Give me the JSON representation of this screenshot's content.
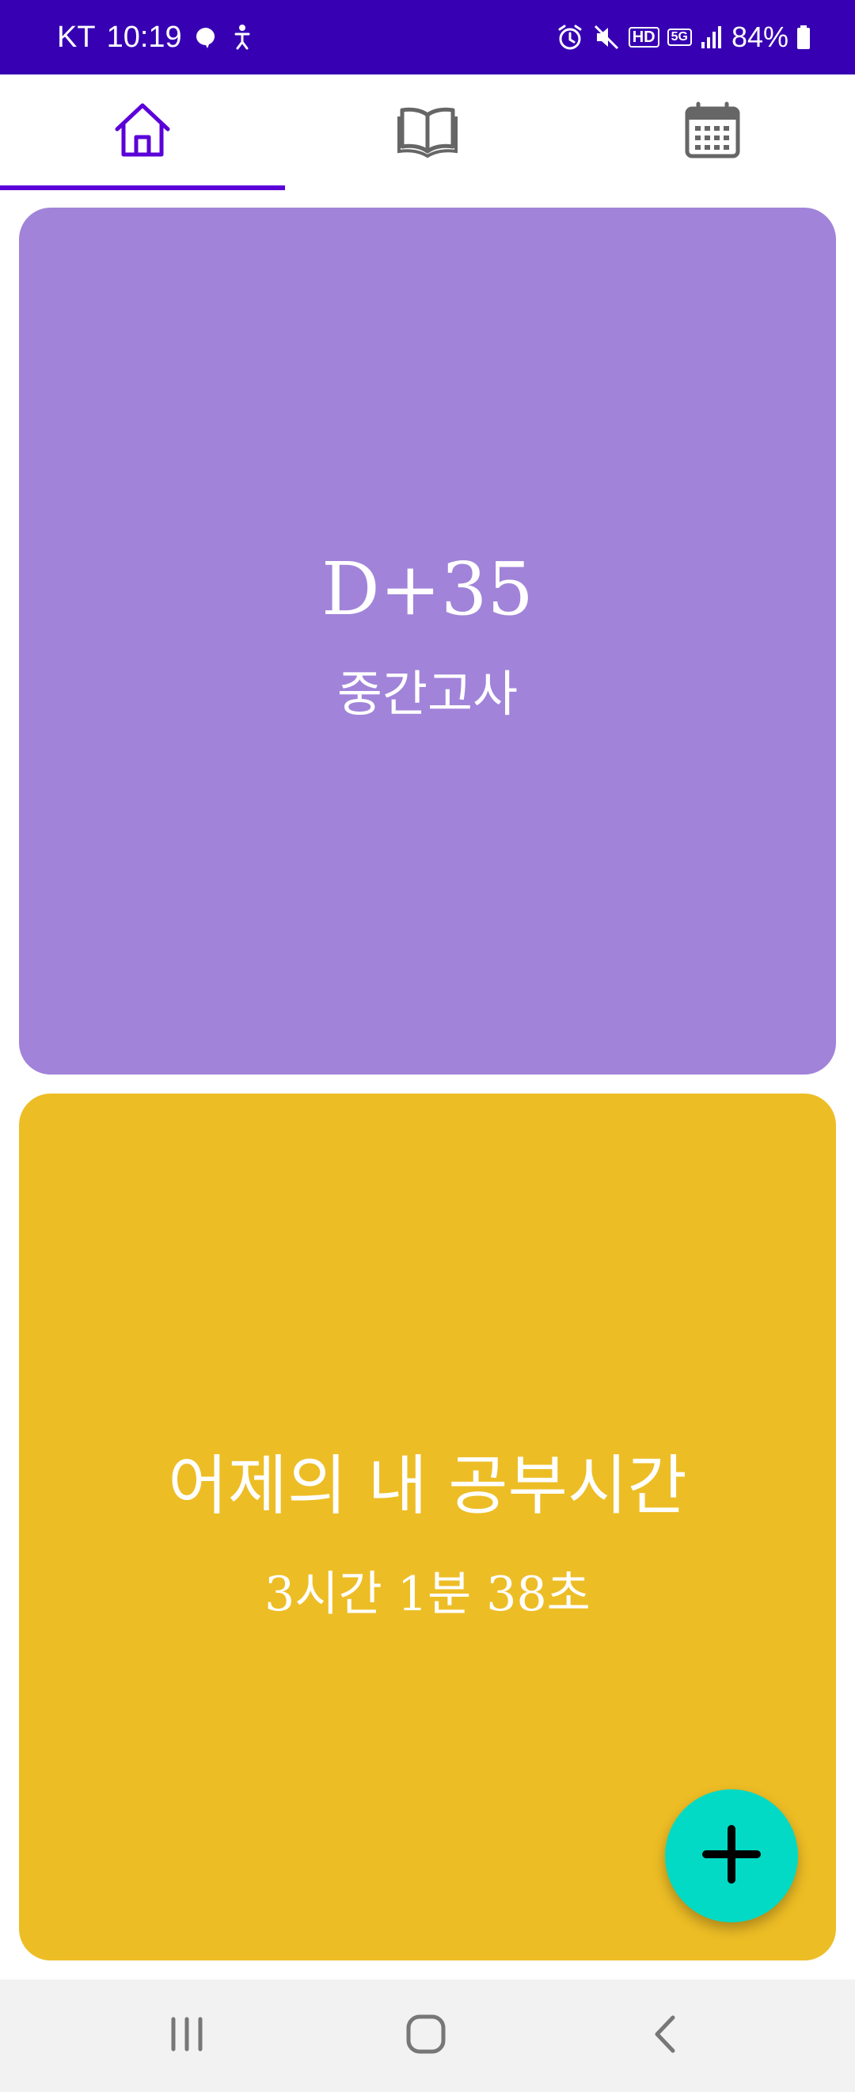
{
  "status_bar": {
    "carrier": "KT",
    "time": "10:19",
    "network_label": "HD",
    "network_gen": "5G",
    "battery": "84%"
  },
  "tabs": [
    {
      "id": "home",
      "icon": "home-icon",
      "selected": true
    },
    {
      "id": "book",
      "icon": "book-icon",
      "selected": false
    },
    {
      "id": "calendar",
      "icon": "calendar-icon",
      "selected": false
    }
  ],
  "colors": {
    "status_bar": "#3700b3",
    "tab_selected": "#5b00d8",
    "tab_unselected": "#666666",
    "card_dday": "#a183d9",
    "card_study": "#edbd25",
    "fab": "#03dac5"
  },
  "dday_card": {
    "title": "D+35",
    "subtitle": "중간고사"
  },
  "study_card": {
    "title": "어제의 내 공부시간",
    "subtitle": "3시간 1분 38초"
  },
  "fab": {
    "icon": "plus-icon"
  },
  "nav_bar": {
    "icons": [
      "recent-apps-icon",
      "home-button-icon",
      "back-icon"
    ]
  }
}
